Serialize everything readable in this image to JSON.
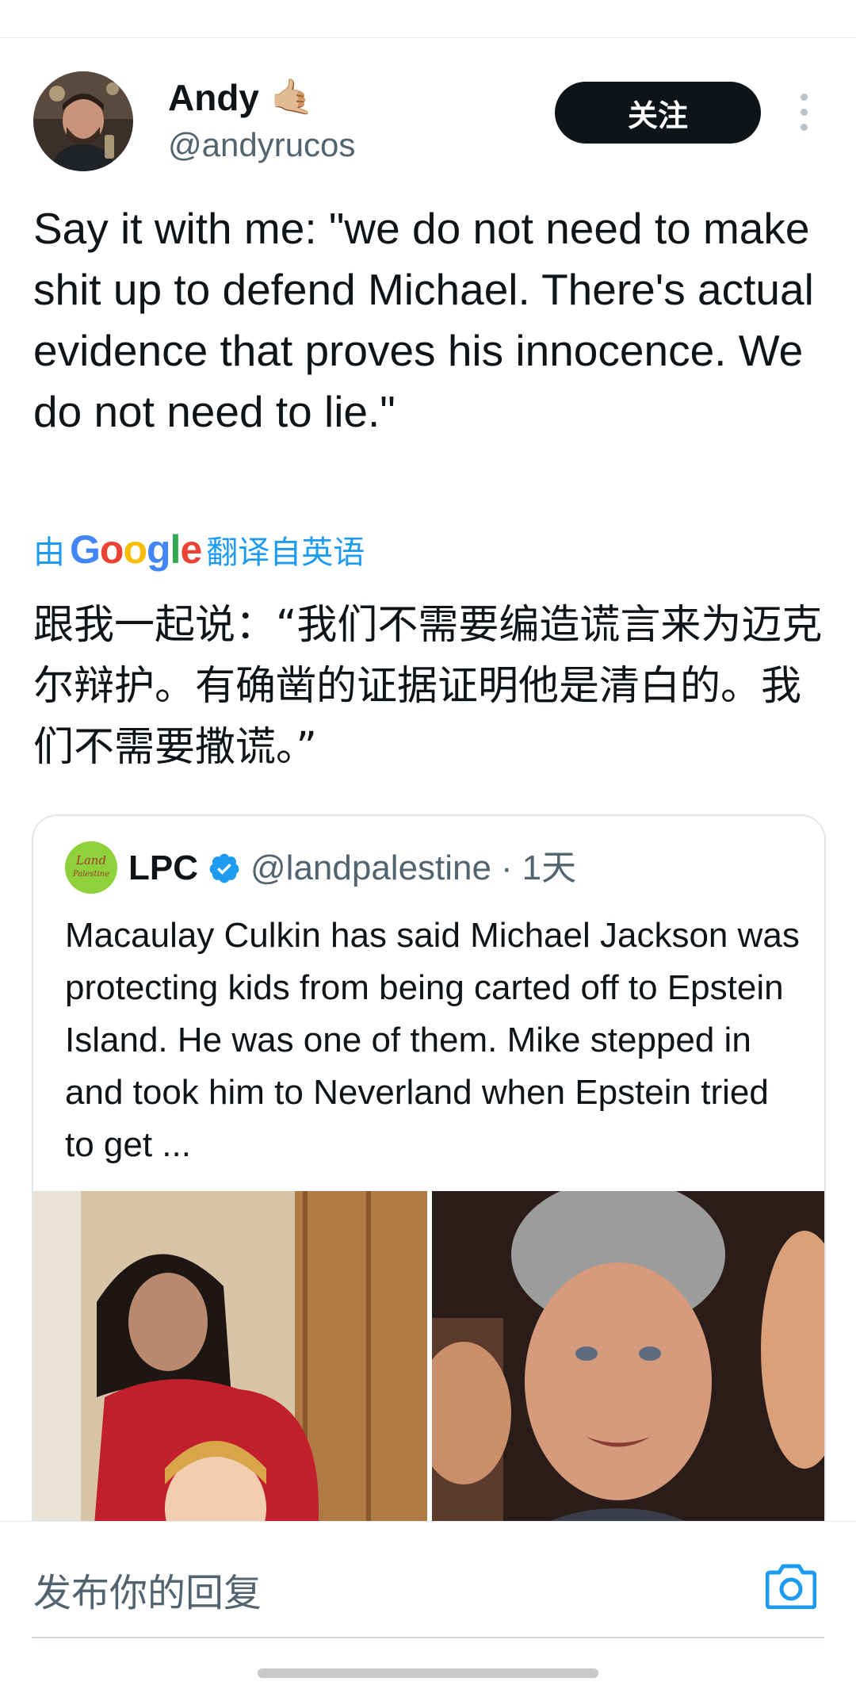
{
  "author": {
    "name": "Andy",
    "emoji": "🤙🏼",
    "handle": "@andyrucos"
  },
  "follow_label": "关注",
  "tweet": {
    "text": "Say it with me: \"we do not need to make shit up to defend Michael. There's actual evidence that proves his innocence. We do not need to lie.\"",
    "translated_by_prefix": "由",
    "translated_by_brand": "Google",
    "translated_by_suffix": "翻译自英语",
    "translation": "跟我一起说：“我们不需要编造谎言来为迈克尔辩护。有确凿的证据证明他是清白的。我们不需要撒谎。”"
  },
  "quote": {
    "avatar_text": "Land Palestine",
    "name": "LPC",
    "handle": "@landpalestine",
    "separator": "·",
    "time": "1天",
    "text": "Macaulay Culkin has said Michael Jackson was protecting kids from being carted off to Epstein Island. He was one of them. Mike stepped in and took him to Neverland when Epstein tried to get ...",
    "images": [
      "photo-two-people",
      "photo-man-portrait"
    ]
  },
  "reply": {
    "placeholder": "发布你的回复"
  },
  "colors": {
    "accent": "#1d9bf0",
    "text": "#0f1419",
    "secondary": "#536471",
    "button": "#0f1419"
  }
}
